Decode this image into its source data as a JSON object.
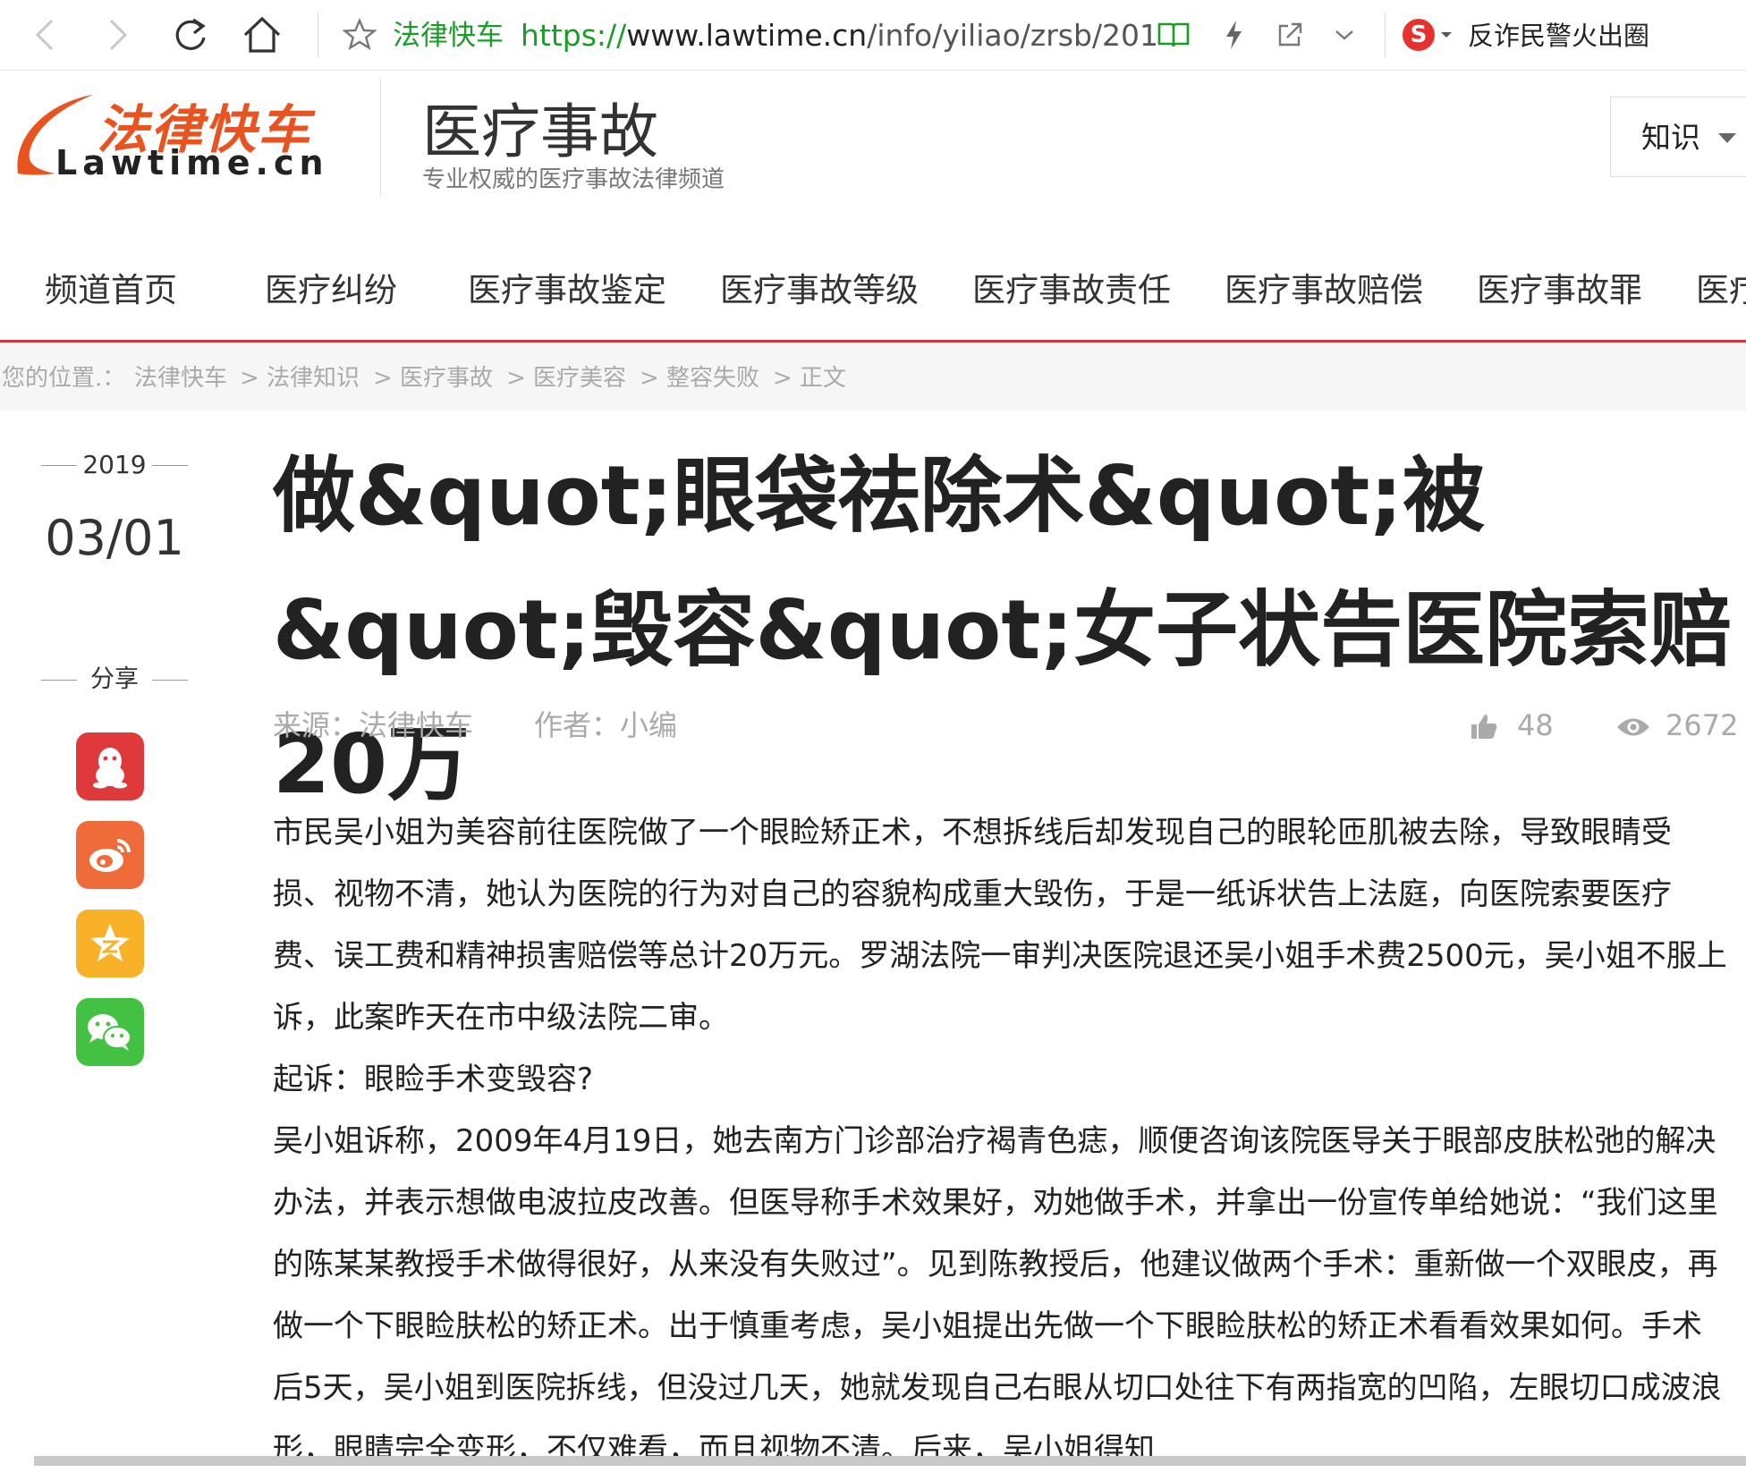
{
  "browser": {
    "site_name": "法律快车",
    "url_scheme": "https://",
    "url_host": "www.lawtime.cn",
    "url_path": "/info/yiliao/zrsb/201",
    "promo_text": "反诈民警火出圈",
    "sogou_letter": "S"
  },
  "header": {
    "logo_zh": "法律快车",
    "logo_en": "Lawtime.cn",
    "channel_title": "医疗事故",
    "channel_subtitle": "专业权威的医疗事故法律频道",
    "search_type": "知识"
  },
  "nav": [
    "频道首页",
    "医疗纠纷",
    "医疗事故鉴定",
    "医疗事故等级",
    "医疗事故责任",
    "医疗事故赔偿",
    "医疗事故罪",
    "医疗"
  ],
  "breadcrumb": {
    "prefix": "您的位置.：",
    "items": [
      "法律快车",
      "法律知识",
      "医疗事故",
      "医疗美容",
      "整容失败",
      "正文"
    ],
    "separator": ">"
  },
  "sidebar": {
    "year": "2019",
    "date": "03/01",
    "share_label": "分享",
    "share_icons": [
      "qq-icon",
      "weibo-icon",
      "qzone-icon",
      "wechat-icon"
    ]
  },
  "article": {
    "title": "做&quot;眼袋祛除术&quot;被&quot;毁容&quot;女子状告医院索赔20万",
    "source": "来源：法律快车",
    "author": "作者：小编",
    "likes": "48",
    "views": "2672",
    "paragraphs": [
      "市民吴小姐为美容前往医院做了一个眼睑矫正术，不想拆线后却发现自己的眼轮匝肌被去除，导致眼睛受损、视物不清，她认为医院的行为对自己的容貌构成重大毁伤，于是一纸诉状告上法庭，向医院索要医疗费、误工费和精神损害赔偿等总计20万元。罗湖法院一审判决医院退还吴小姐手术费2500元，吴小姐不服上诉，此案昨天在市中级法院二审。",
      "起诉：眼睑手术变毁容?",
      "吴小姐诉称，2009年4月19日，她去南方门诊部治疗褐青色痣，顺便咨询该院医导关于眼部皮肤松弛的解决办法，并表示想做电波拉皮改善。但医导称手术效果好，劝她做手术，并拿出一份宣传单给她说：“我们这里的陈某某教授手术做得很好，从来没有失败过”。见到陈教授后，他建议做两个手术：重新做一个双眼皮，再做一个下眼睑肤松的矫正术。出于慎重考虑，吴小姐提出先做一个下眼睑肤松的矫正术看看效果如何。手术后5天，吴小姐到医院拆线，但没过几天，她就发现自己右眼从切口处往下有两指宽的凹陷，左眼切口成波浪形，眼睛完全变形，不仅难看，而且视物不清。后来，吴小姐得知"
    ]
  },
  "colors": {
    "accent_red": "#d9363a",
    "logo_orange": "#e8531f",
    "url_green": "#1a9c28",
    "qq": "#e0393b",
    "weibo": "#f06b3a",
    "qzone": "#f9b128",
    "wechat": "#42c142"
  }
}
